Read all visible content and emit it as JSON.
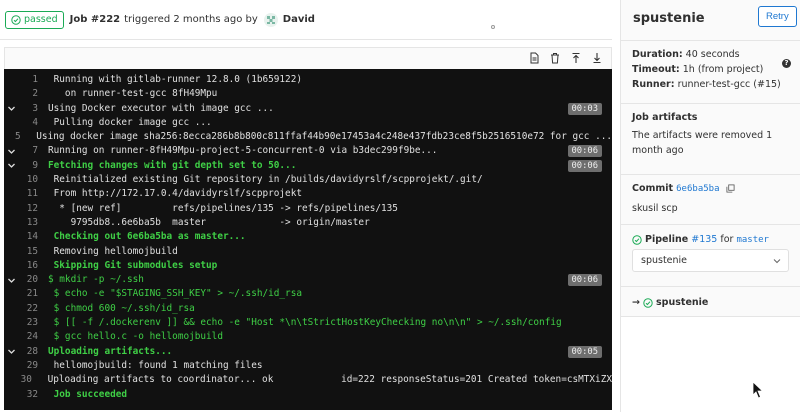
{
  "header": {
    "status": "passed",
    "job_label": "Job #222",
    "triggered_text": "triggered 2 months ago by",
    "user": "David"
  },
  "toolbar": {
    "icons": [
      "raw-log-icon",
      "erase-log-icon",
      "scroll-top-icon",
      "scroll-bottom-icon"
    ]
  },
  "log": {
    "lines": [
      {
        "n": "1",
        "text": " Running with gitlab-runner 12.8.0 (1b659122)",
        "style": "normal",
        "chevron": false,
        "dur": ""
      },
      {
        "n": "2",
        "text": "   on runner-test-gcc 8fH49Mpu",
        "style": "normal",
        "chevron": false,
        "dur": ""
      },
      {
        "n": "3",
        "text": "Using Docker executor with image gcc ...",
        "style": "normal",
        "chevron": true,
        "dur": "00:03"
      },
      {
        "n": "4",
        "text": " Pulling docker image gcc ...",
        "style": "normal",
        "chevron": false,
        "dur": ""
      },
      {
        "n": "5",
        "text": " Using docker image sha256:8ecca286b8b800c811ffaf44b90e17453a4c248e437fdb23ce8f5b2516510e72 for gcc ...",
        "style": "normal",
        "chevron": false,
        "dur": ""
      },
      {
        "n": "7",
        "text": "Running on runner-8fH49Mpu-project-5-concurrent-0 via b3dec299f9be...",
        "style": "normal",
        "chevron": true,
        "dur": "00:06"
      },
      {
        "n": "9",
        "text": "Fetching changes with git depth set to 50...",
        "style": "green",
        "chevron": true,
        "dur": "00:06"
      },
      {
        "n": "10",
        "text": " Reinitialized existing Git repository in /builds/davidyrslf/scpprojekt/.git/",
        "style": "normal",
        "chevron": false,
        "dur": ""
      },
      {
        "n": "11",
        "text": " From http://172.17.0.4/davidyrslf/scpprojekt",
        "style": "normal",
        "chevron": false,
        "dur": ""
      },
      {
        "n": "12",
        "text": "  * [new ref]         refs/pipelines/135 -> refs/pipelines/135",
        "style": "normal",
        "chevron": false,
        "dur": ""
      },
      {
        "n": "13",
        "text": "    9795db8..6e6ba5b  master             -> origin/master",
        "style": "normal",
        "chevron": false,
        "dur": ""
      },
      {
        "n": "14",
        "text": " Checking out 6e6ba5ba as master...",
        "style": "green",
        "chevron": false,
        "dur": ""
      },
      {
        "n": "15",
        "text": " Removing hellomojbuild",
        "style": "normal",
        "chevron": false,
        "dur": ""
      },
      {
        "n": "16",
        "text": " Skipping Git submodules setup",
        "style": "green",
        "chevron": false,
        "dur": ""
      },
      {
        "n": "20",
        "text": "$ mkdir -p ~/.ssh",
        "style": "greenr",
        "chevron": true,
        "dur": "00:06"
      },
      {
        "n": "21",
        "text": " $ echo -e \"$STAGING_SSH_KEY\" > ~/.ssh/id_rsa",
        "style": "greenr",
        "chevron": false,
        "dur": ""
      },
      {
        "n": "22",
        "text": " $ chmod 600 ~/.ssh/id_rsa",
        "style": "greenr",
        "chevron": false,
        "dur": ""
      },
      {
        "n": "23",
        "text": " $ [[ -f /.dockerenv ]] && echo -e \"Host *\\n\\tStrictHostKeyChecking no\\n\\n\" > ~/.ssh/config",
        "style": "greenr",
        "chevron": false,
        "dur": ""
      },
      {
        "n": "24",
        "text": " $ gcc hello.c -o hellomojbuild",
        "style": "greenr",
        "chevron": false,
        "dur": ""
      },
      {
        "n": "28",
        "text": "Uploading artifacts...",
        "style": "green",
        "chevron": true,
        "dur": "00:05"
      },
      {
        "n": "29",
        "text": " hellomojbuild: found 1 matching files",
        "style": "normal",
        "chevron": false,
        "dur": ""
      },
      {
        "n": "30",
        "text": " Uploading artifacts to coordinator... ok            id=222 responseStatus=201 Created token=csMTXiZX",
        "style": "normal",
        "chevron": false,
        "dur": ""
      },
      {
        "n": "32",
        "text": " Job succeeded",
        "style": "green",
        "chevron": false,
        "dur": ""
      }
    ]
  },
  "sidebar": {
    "title": "spustenie",
    "retry_label": "Retry",
    "duration_label": "Duration:",
    "duration_value": "40 seconds",
    "timeout_label": "Timeout:",
    "timeout_value": "1h (from project)",
    "runner_label": "Runner:",
    "runner_value": "runner-test-gcc (#15)",
    "artifacts_heading": "Job artifacts",
    "artifacts_text": "The artifacts were removed 1 month ago",
    "commit_label": "Commit",
    "commit_sha": "6e6ba5ba",
    "commit_message": "skusil scp",
    "pipeline_label": "Pipeline",
    "pipeline_id": "#135",
    "pipeline_for": "for",
    "pipeline_branch": "master",
    "stage_select": "spustenie",
    "job_item": "spustenie"
  },
  "colors": {
    "success": "#1aaa55",
    "link": "#1f78d1",
    "log_bg": "#111111",
    "log_green": "#3fcf46"
  }
}
